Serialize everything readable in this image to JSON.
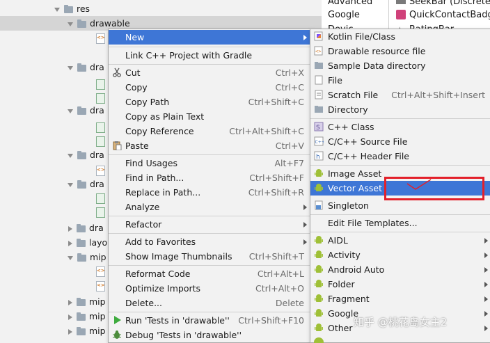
{
  "tree": {
    "rows": [
      {
        "label": "res",
        "expanded": true
      },
      {
        "label": "drawable",
        "expanded": true
      },
      {
        "label": "dra"
      },
      {
        "label": "dra"
      },
      {
        "label": "dra"
      },
      {
        "label": "dra"
      },
      {
        "label": "dra"
      },
      {
        "label": "layo"
      },
      {
        "label": "mip"
      },
      {
        "label": "mip"
      },
      {
        "label": "mip"
      },
      {
        "label": "mip"
      }
    ]
  },
  "palette": {
    "items": [
      "Advanced",
      "Google",
      "Devic",
      "SeekBar (Discrete)",
      "QuickContactBadge",
      "RatingBar"
    ]
  },
  "context_menu": {
    "items": [
      {
        "label": "New"
      },
      {
        "label": "Link C++ Project with Gradle"
      },
      {
        "label": "Cut",
        "shortcut": "Ctrl+X"
      },
      {
        "label": "Copy",
        "shortcut": "Ctrl+C"
      },
      {
        "label": "Copy Path",
        "shortcut": "Ctrl+Shift+C"
      },
      {
        "label": "Copy as Plain Text"
      },
      {
        "label": "Copy Reference",
        "shortcut": "Ctrl+Alt+Shift+C"
      },
      {
        "label": "Paste",
        "shortcut": "Ctrl+V"
      },
      {
        "label": "Find Usages",
        "shortcut": "Alt+F7"
      },
      {
        "label": "Find in Path...",
        "shortcut": "Ctrl+Shift+F"
      },
      {
        "label": "Replace in Path...",
        "shortcut": "Ctrl+Shift+R"
      },
      {
        "label": "Analyze"
      },
      {
        "label": "Refactor"
      },
      {
        "label": "Add to Favorites"
      },
      {
        "label": "Show Image Thumbnails",
        "shortcut": "Ctrl+Shift+T"
      },
      {
        "label": "Reformat Code",
        "shortcut": "Ctrl+Alt+L"
      },
      {
        "label": "Optimize Imports",
        "shortcut": "Ctrl+Alt+O"
      },
      {
        "label": "Delete...",
        "shortcut": "Delete"
      },
      {
        "label": "Run 'Tests in 'drawable''",
        "shortcut": "Ctrl+Shift+F10"
      },
      {
        "label": "Debug 'Tests in 'drawable''"
      }
    ]
  },
  "submenu": {
    "items": [
      {
        "label": "Kotlin File/Class"
      },
      {
        "label": "Drawable resource file"
      },
      {
        "label": "Sample Data directory"
      },
      {
        "label": "File"
      },
      {
        "label": "Scratch File",
        "shortcut": "Ctrl+Alt+Shift+Insert"
      },
      {
        "label": "Directory"
      },
      {
        "label": "C++ Class"
      },
      {
        "label": "C/C++ Source File"
      },
      {
        "label": "C/C++ Header File"
      },
      {
        "label": "Image Asset"
      },
      {
        "label": "Vector Asset"
      },
      {
        "label": "Singleton"
      },
      {
        "label": "Edit File Templates..."
      },
      {
        "label": "AIDL"
      },
      {
        "label": "Activity"
      },
      {
        "label": "Android Auto"
      },
      {
        "label": "Folder"
      },
      {
        "label": "Fragment"
      },
      {
        "label": "Google"
      },
      {
        "label": "Other"
      }
    ]
  },
  "watermark": "知乎 @桃花岛女主2",
  "colors": {
    "selection": "#3e76d6",
    "menu_bg": "#f2f2f2",
    "annotation": "#e3202a",
    "android_green": "#9fc037"
  }
}
